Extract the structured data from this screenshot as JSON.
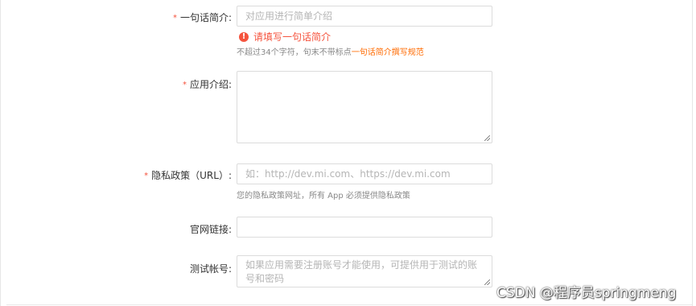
{
  "form": {
    "intro": {
      "label": "一句话简介",
      "required_mark": "*",
      "placeholder": "对应用进行简单介绍",
      "error": "请填写一句话简介",
      "hint_prefix": "不超过34个字符，句末不带标点",
      "hint_link": "一句话简介撰写规范"
    },
    "description": {
      "label": "应用介绍",
      "required_mark": "*"
    },
    "privacy": {
      "label": "隐私政策（URL）",
      "required_mark": "*",
      "placeholder": "如：http://dev.mi.com、https://dev.mi.com",
      "hint": "您的隐私政策网址，所有 App 必须提供隐私政策"
    },
    "website": {
      "label": "官网链接"
    },
    "test_account": {
      "label": "测试帐号",
      "placeholder": "如果应用需要注册账号才能使用，可提供用于测试的账号和密码"
    }
  },
  "colon": ":",
  "watermark": "CSDN @程序员springmeng",
  "colors": {
    "required": "#f5533d",
    "link": "#ff6a00",
    "border": "#dcdcdc"
  }
}
